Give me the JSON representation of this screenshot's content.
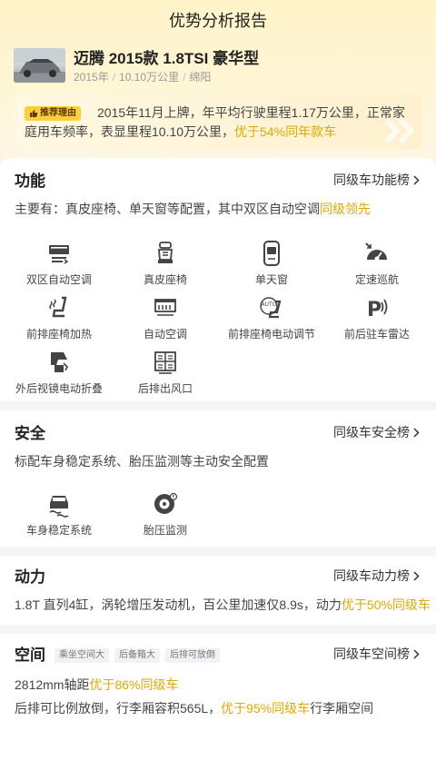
{
  "page": {
    "title": "优势分析报告"
  },
  "car": {
    "name": "迈腾 2015款 1.8TSI 豪华型",
    "year": "2015年",
    "mileage": "10.10万公里",
    "city": "绵阳"
  },
  "reason": {
    "tag": "推荐理由",
    "text_plain": "2015年11月上牌，年平均行驶里程1.17万公里，正常家庭用车频率，表显里程10.10万公里，",
    "text_highlight": "优于54%同年款车"
  },
  "function": {
    "title": "功能",
    "link": "同级车功能榜",
    "desc_plain": "主要有：真皮座椅、单天窗等配置，其中双区自动空调",
    "desc_highlight": "同级领先",
    "features": [
      {
        "label": "双区自动空调",
        "icon": "dual-ac-icon"
      },
      {
        "label": "真皮座椅",
        "icon": "leather-seat-icon"
      },
      {
        "label": "单天窗",
        "icon": "sunroof-icon"
      },
      {
        "label": "定速巡航",
        "icon": "cruise-control-icon"
      },
      {
        "label": "前排座椅加热",
        "icon": "seat-heating-icon"
      },
      {
        "label": "自动空调",
        "icon": "auto-ac-icon"
      },
      {
        "label": "前排座椅电动调节",
        "icon": "power-seat-icon"
      },
      {
        "label": "前后驻车雷达",
        "icon": "parking-radar-icon"
      },
      {
        "label": "外后视镜电动折叠",
        "icon": "mirror-fold-icon"
      },
      {
        "label": "后排出风口",
        "icon": "rear-vent-icon"
      }
    ]
  },
  "safety": {
    "title": "安全",
    "link": "同级车安全榜",
    "desc": "标配车身稳定系统、胎压监测等主动安全配置",
    "features": [
      {
        "label": "车身稳定系统",
        "icon": "stability-control-icon"
      },
      {
        "label": "胎压监测",
        "icon": "tire-pressure-icon"
      }
    ]
  },
  "power": {
    "title": "动力",
    "link": "同级车动力榜",
    "desc_plain": "1.8T 直列4缸，涡轮增压发动机，百公里加速仅8.9s，动力",
    "desc_highlight": "优于50%同级车"
  },
  "space": {
    "title": "空间",
    "link": "同级车空间榜",
    "tags": [
      "乘坐空间大",
      "后备箱大",
      "后排可放倒"
    ],
    "line1_plain": "2812mm轴距",
    "line1_highlight": "优于86%同级车",
    "line2_plain_a": "后排可比例放倒，行李厢容积565L，",
    "line2_highlight": "优于95%同级车",
    "line2_plain_b": "行李厢空间"
  },
  "colors": {
    "accent": "#e0a800",
    "tag_bg": "#ffcf3a",
    "header_bg": "#fff3c8"
  }
}
